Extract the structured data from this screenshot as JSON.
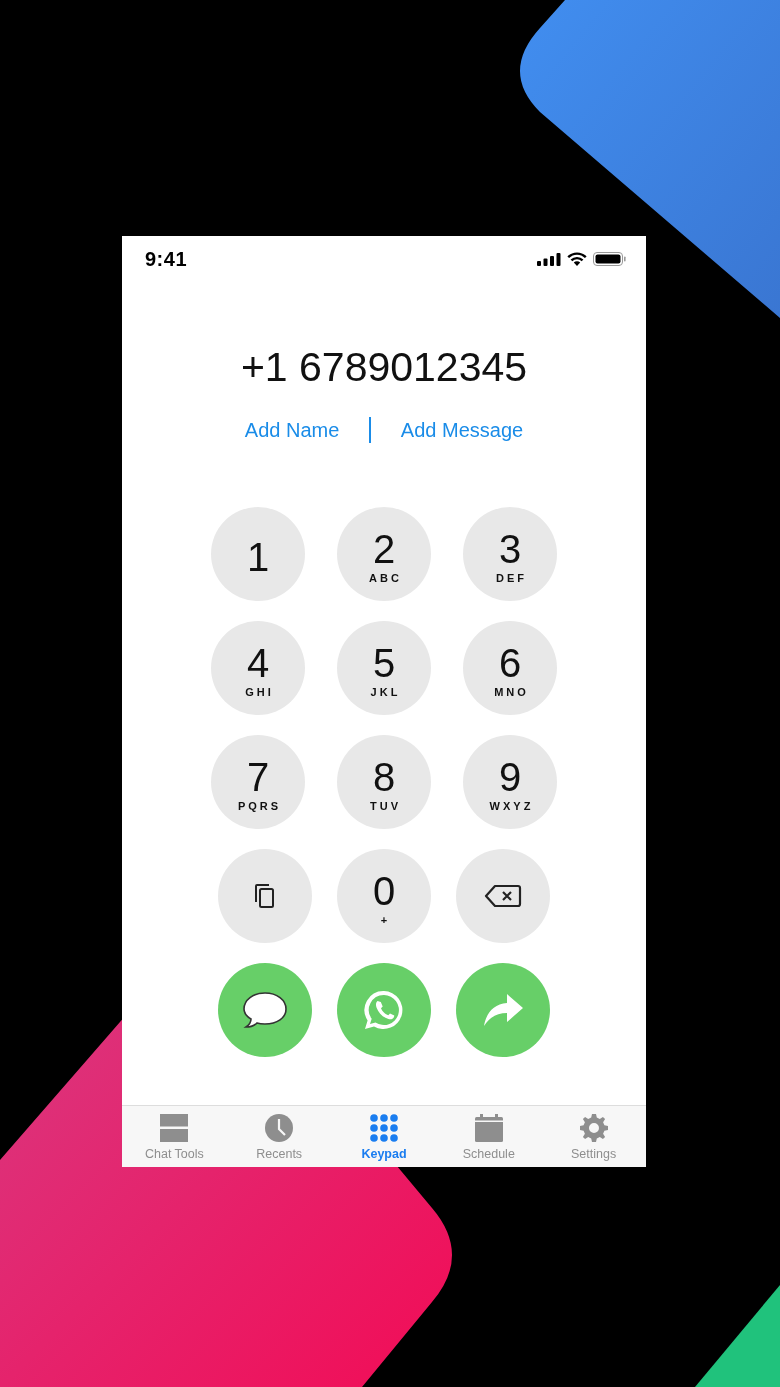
{
  "status_bar": {
    "time": "9:41"
  },
  "dialed_number": "+1 6789012345",
  "links": [
    {
      "label": "Add Name"
    },
    {
      "label": "Add Message"
    }
  ],
  "keypad": [
    [
      {
        "kind": "digit",
        "digit": "1"
      },
      {
        "kind": "digit",
        "digit": "2",
        "letters": "ABC"
      },
      {
        "kind": "digit",
        "digit": "3",
        "letters": "DEF"
      }
    ],
    [
      {
        "kind": "digit",
        "digit": "4",
        "letters": "GHI"
      },
      {
        "kind": "digit",
        "digit": "5",
        "letters": "JKL"
      },
      {
        "kind": "digit",
        "digit": "6",
        "letters": "MNO"
      }
    ],
    [
      {
        "kind": "digit",
        "digit": "7",
        "letters": "PQRS"
      },
      {
        "kind": "digit",
        "digit": "8",
        "letters": "TUV"
      },
      {
        "kind": "digit",
        "digit": "9",
        "letters": "WXYZ"
      }
    ],
    [
      {
        "kind": "paste"
      },
      {
        "kind": "digit",
        "digit": "0",
        "letters": "+"
      },
      {
        "kind": "delete"
      }
    ]
  ],
  "actions": [
    {
      "kind": "message"
    },
    {
      "kind": "whatsapp"
    },
    {
      "kind": "forward"
    }
  ],
  "tabs": [
    {
      "label": "Chat Tools",
      "kind": "tools",
      "selected": false
    },
    {
      "label": "Recents",
      "kind": "recents",
      "selected": false
    },
    {
      "label": "Keypad",
      "kind": "keypad",
      "selected": true
    },
    {
      "label": "Schedule",
      "kind": "schedule",
      "selected": false
    },
    {
      "label": "Settings",
      "kind": "settings",
      "selected": false
    }
  ]
}
